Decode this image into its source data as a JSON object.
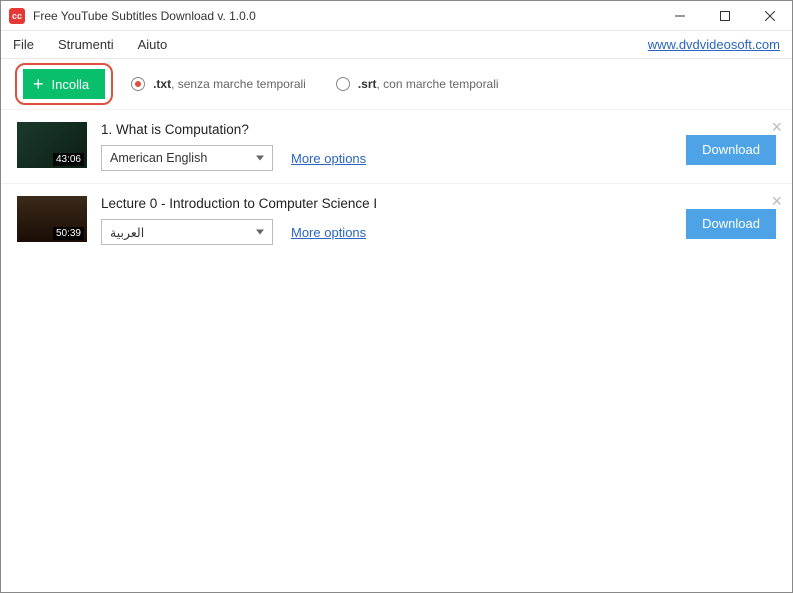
{
  "titlebar": {
    "app_icon_text": "cc",
    "title": "Free YouTube Subtitles Download v. 1.0.0"
  },
  "menubar": {
    "items": [
      "File",
      "Strumenti",
      "Aiuto"
    ],
    "link": "www.dvdvideosoft.com"
  },
  "toolbar": {
    "paste_label": "Incolla",
    "options": [
      {
        "bold": ".txt",
        "rest": ", senza marche temporali",
        "selected": true
      },
      {
        "bold": ".srt",
        "rest": ", con marche temporali",
        "selected": false
      }
    ]
  },
  "items": [
    {
      "title": "1. What is Computation?",
      "duration": "43:06",
      "language": "American English",
      "more": "More options",
      "download": "Download",
      "scene": "scene1"
    },
    {
      "title": "Lecture 0 - Introduction to Computer Science I",
      "duration": "50:39",
      "language": "العربية",
      "more": "More options",
      "download": "Download",
      "scene": "scene2"
    }
  ]
}
